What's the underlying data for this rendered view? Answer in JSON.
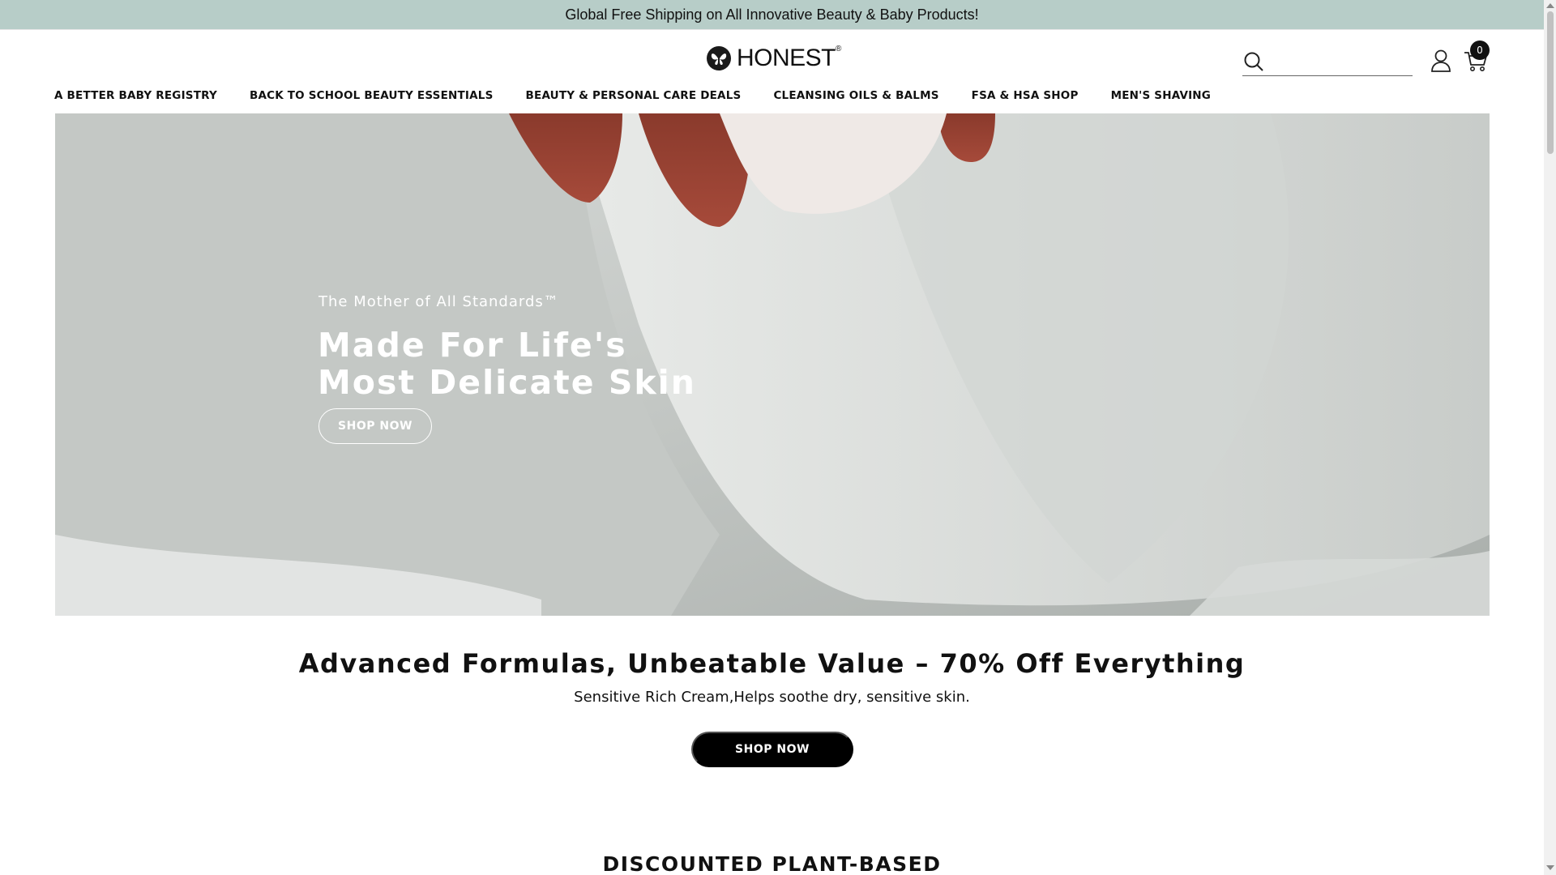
{
  "announcement": "Global Free Shipping on All Innovative Beauty & Baby Products!",
  "brand": {
    "name": "HONEST",
    "mark": "®"
  },
  "search": {
    "placeholder": ""
  },
  "cart": {
    "count": "0"
  },
  "nav": [
    "A BETTER BABY REGISTRY",
    "BACK TO SCHOOL BEAUTY ESSENTIALS",
    "BEAUTY & PERSONAL CARE DEALS",
    "CLEANSING OILS & BALMS",
    "FSA & HSA SHOP",
    "MEN'S SHAVING"
  ],
  "hero": {
    "eyebrow": "The Mother of All Standards™",
    "title_line1": "Made For Life's",
    "title_line2": "Most Delicate Skin",
    "button": "SHOP NOW"
  },
  "promo": {
    "title": "Advanced Formulas, Unbeatable Value – 70% Off Everything",
    "subtitle": "Sensitive Rich Cream,Helps soothe dry, sensitive skin.",
    "button": "SHOP NOW"
  },
  "section": {
    "title": "DISCOUNTED PLANT-BASED"
  },
  "icons": {
    "search": "search-icon",
    "account": "account-icon",
    "cart": "cart-icon",
    "logo": "butterfly-logo-icon"
  },
  "colors": {
    "announcement_bg": "#b7cdc8",
    "button_dark": "#000000",
    "text": "#111111"
  }
}
